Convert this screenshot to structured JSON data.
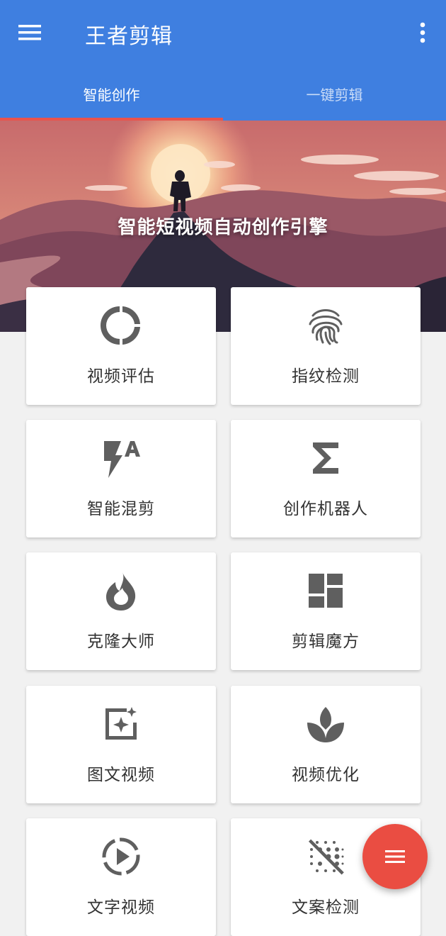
{
  "appbar": {
    "title": "王者剪辑",
    "menu_icon": "hamburger-menu-icon",
    "more_icon": "more-vertical-icon",
    "background_color": "#3f7fe0"
  },
  "tabs": [
    {
      "label": "智能创作",
      "active": true
    },
    {
      "label": "一键剪辑",
      "active": false
    }
  ],
  "tab_indicator_color": "#e9534b",
  "banner": {
    "caption": "智能短视频自动创作引擎"
  },
  "features": [
    {
      "label": "视频评估",
      "icon": "donut-chart-icon"
    },
    {
      "label": "指纹检测",
      "icon": "fingerprint-icon"
    },
    {
      "label": "智能混剪",
      "icon": "flash-auto-icon"
    },
    {
      "label": "创作机器人",
      "icon": "sigma-icon"
    },
    {
      "label": "克隆大师",
      "icon": "flame-icon"
    },
    {
      "label": "剪辑魔方",
      "icon": "dashboard-grid-icon"
    },
    {
      "label": "图文视频",
      "icon": "image-sparkle-icon"
    },
    {
      "label": "视频优化",
      "icon": "spa-leaf-icon"
    },
    {
      "label": "文字视频",
      "icon": "play-circle-dashed-icon"
    },
    {
      "label": "文案检测",
      "icon": "blur-off-icon"
    }
  ],
  "fab": {
    "icon": "menu-lines-icon",
    "color": "#ea4d42"
  }
}
